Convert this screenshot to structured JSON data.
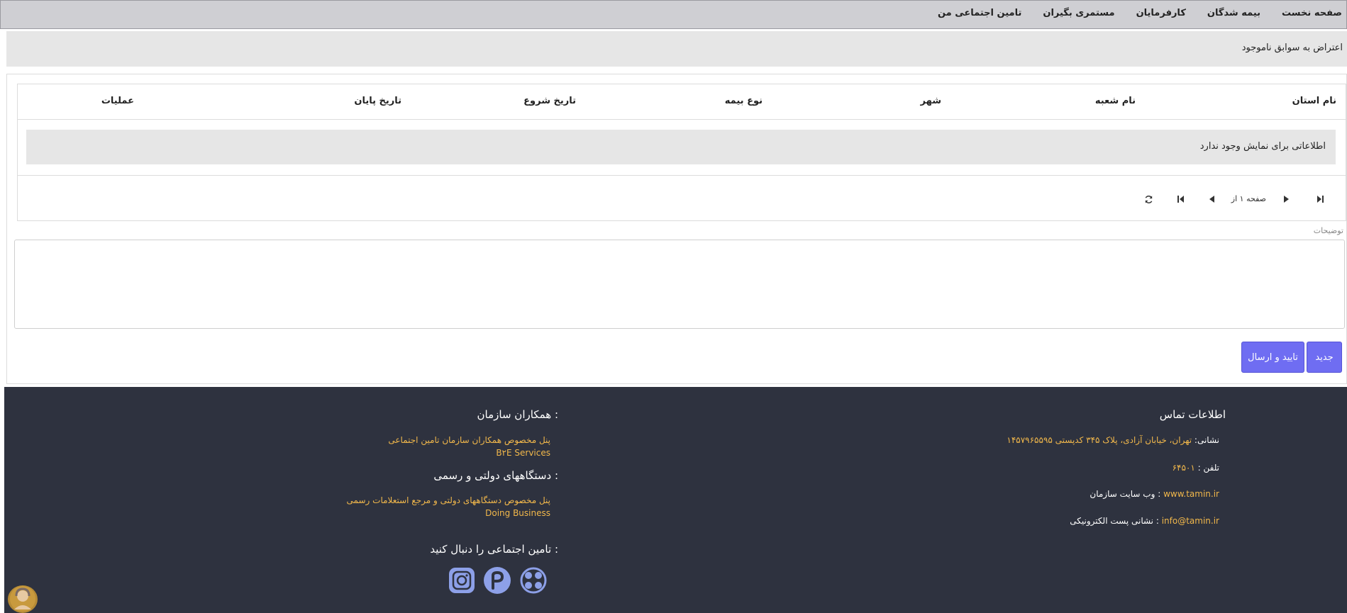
{
  "nav": {
    "items": [
      "صفحه نخست",
      "بیمه شدگان",
      "کارفرمایان",
      "مستمری بگیران",
      "تامین اجتماعی من"
    ]
  },
  "page": {
    "title": "اعتراض به سوابق ناموجود"
  },
  "grid": {
    "columns": [
      "نام استان",
      "نام شعبه",
      "شهر",
      "نوع بیمه",
      "تاریخ شروع",
      "تاریخ پایان",
      "عملیات"
    ],
    "empty_message": "اطلاعاتی برای نمایش وجود ندارد",
    "pager_text": "صفحه ۱ از"
  },
  "form": {
    "description_label": "توضیحات",
    "description_value": "",
    "new_button": "جدید",
    "submit_button": "تایید و ارسال",
    "accent": "#6f6df2"
  },
  "footer": {
    "contact_title": "اطلاعات تماس",
    "address_label": "نشانی:",
    "address_value": "تهران، خیابان آزادی، پلاک ۳۴۵ کدپستی ۱۴۵۷۹۶۵۵۹۵",
    "phone_label": "تلفن :",
    "phone_value": "۶۴۵۰۱",
    "website_label": "وب سایت سازمان :",
    "website_value": "www.tamin.ir",
    "email_label": "نشانی پست الکترونیکی :",
    "email_value": "info@tamin.ir",
    "partners_title": "همکاران سازمان :",
    "partners_line1": "پنل مخصوص همکاران سازمان تامین اجتماعی",
    "partners_line2": "B۲E Services",
    "gov_title": "دستگاههای دولتی و رسمی :",
    "gov_line1": "پنل مخصوص دستگاههای دولتی و مرجع استعلامات رسمی",
    "gov_line2": "Doing Business",
    "follow_title": "تامین اجتماعی را دنبال کنید :",
    "social_icons": [
      "aparat-icon",
      "rubika-icon",
      "instagram-icon"
    ],
    "background": "#2e323f",
    "link_color": "#f2b84b"
  }
}
